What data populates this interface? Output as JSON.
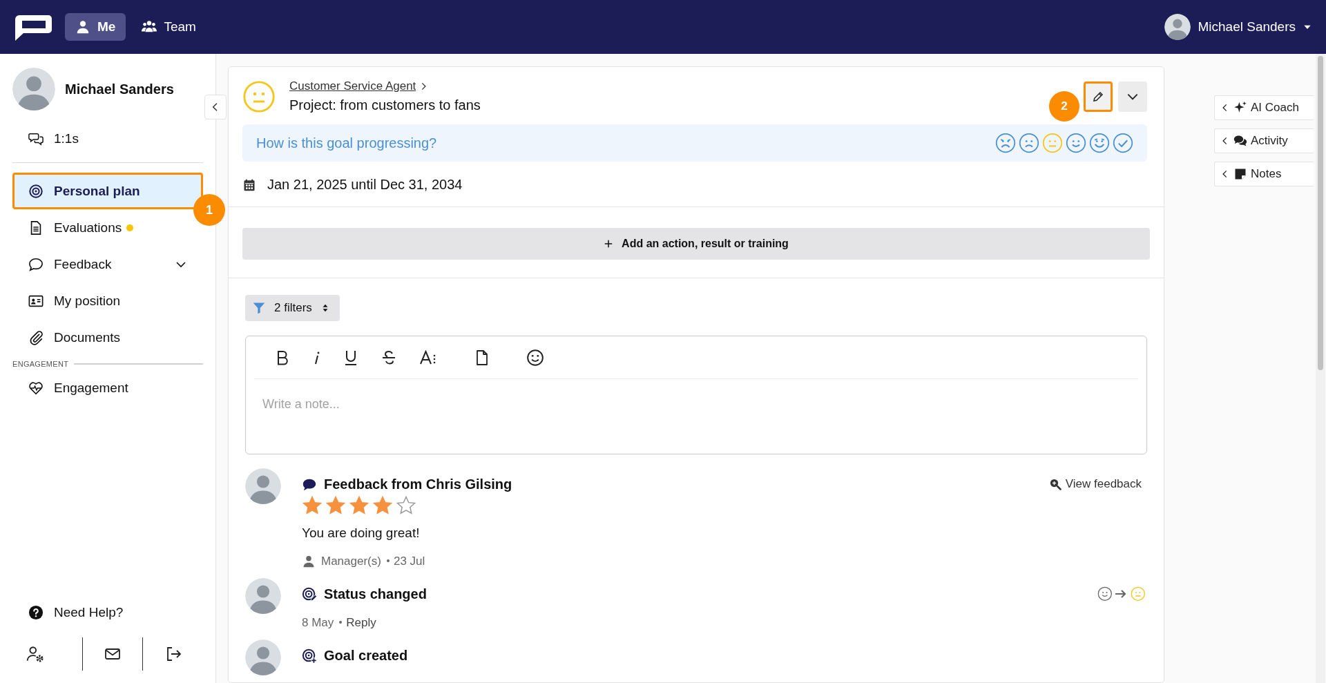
{
  "topbar": {
    "tabs": [
      {
        "label": "Me",
        "selected": true
      },
      {
        "label": "Team",
        "selected": false
      }
    ],
    "user": {
      "name": "Michael Sanders"
    }
  },
  "sidebar": {
    "profile": {
      "name": "Michael Sanders"
    },
    "top_items": [
      {
        "label": "1:1s",
        "selected": false
      }
    ],
    "items": [
      {
        "label": "Personal plan",
        "selected": true,
        "notification": false,
        "callout": "1"
      },
      {
        "label": "Evaluations",
        "selected": false,
        "notification": true
      },
      {
        "label": "Feedback",
        "selected": false,
        "notification": false,
        "expanded": false
      },
      {
        "label": "My position",
        "selected": false,
        "notification": false
      },
      {
        "label": "Documents",
        "selected": false,
        "notification": false
      }
    ],
    "section_heading": "ENGAGEMENT",
    "section_items": [
      {
        "label": "Engagement",
        "selected": false,
        "notification": false
      }
    ],
    "help": "Need Help?"
  },
  "goal": {
    "breadcrumb": "Customer Service Agent",
    "title": "Project: from customers to fans",
    "edit_callout": "2",
    "progress_prompt": "How is this goal progressing?",
    "status_options": [
      {
        "kind": "very-sad",
        "selected": false
      },
      {
        "kind": "sad",
        "selected": false
      },
      {
        "kind": "neutral",
        "selected": true
      },
      {
        "kind": "happy",
        "selected": false
      },
      {
        "kind": "very-happy",
        "selected": false
      },
      {
        "kind": "done",
        "selected": false
      }
    ],
    "dates": "Jan 21, 2025 until Dec 31, 2034",
    "add_button": "Add an action, result or training",
    "filter": "2 filters",
    "editor": {
      "placeholder": "Write a note..."
    },
    "feed": [
      {
        "kind": "feedback",
        "title": "Feedback from Chris Gilsing",
        "stars": 4,
        "text": "You are doing great!",
        "audience": "Manager(s)",
        "date": "23 Jul",
        "action": "View feedback"
      },
      {
        "kind": "status",
        "title": "Status changed",
        "date": "8 May",
        "reply": "Reply"
      },
      {
        "kind": "created",
        "title": "Goal created"
      }
    ]
  },
  "right_tabs": [
    {
      "label": "AI Coach"
    },
    {
      "label": "Activity"
    },
    {
      "label": "Notes"
    }
  ]
}
